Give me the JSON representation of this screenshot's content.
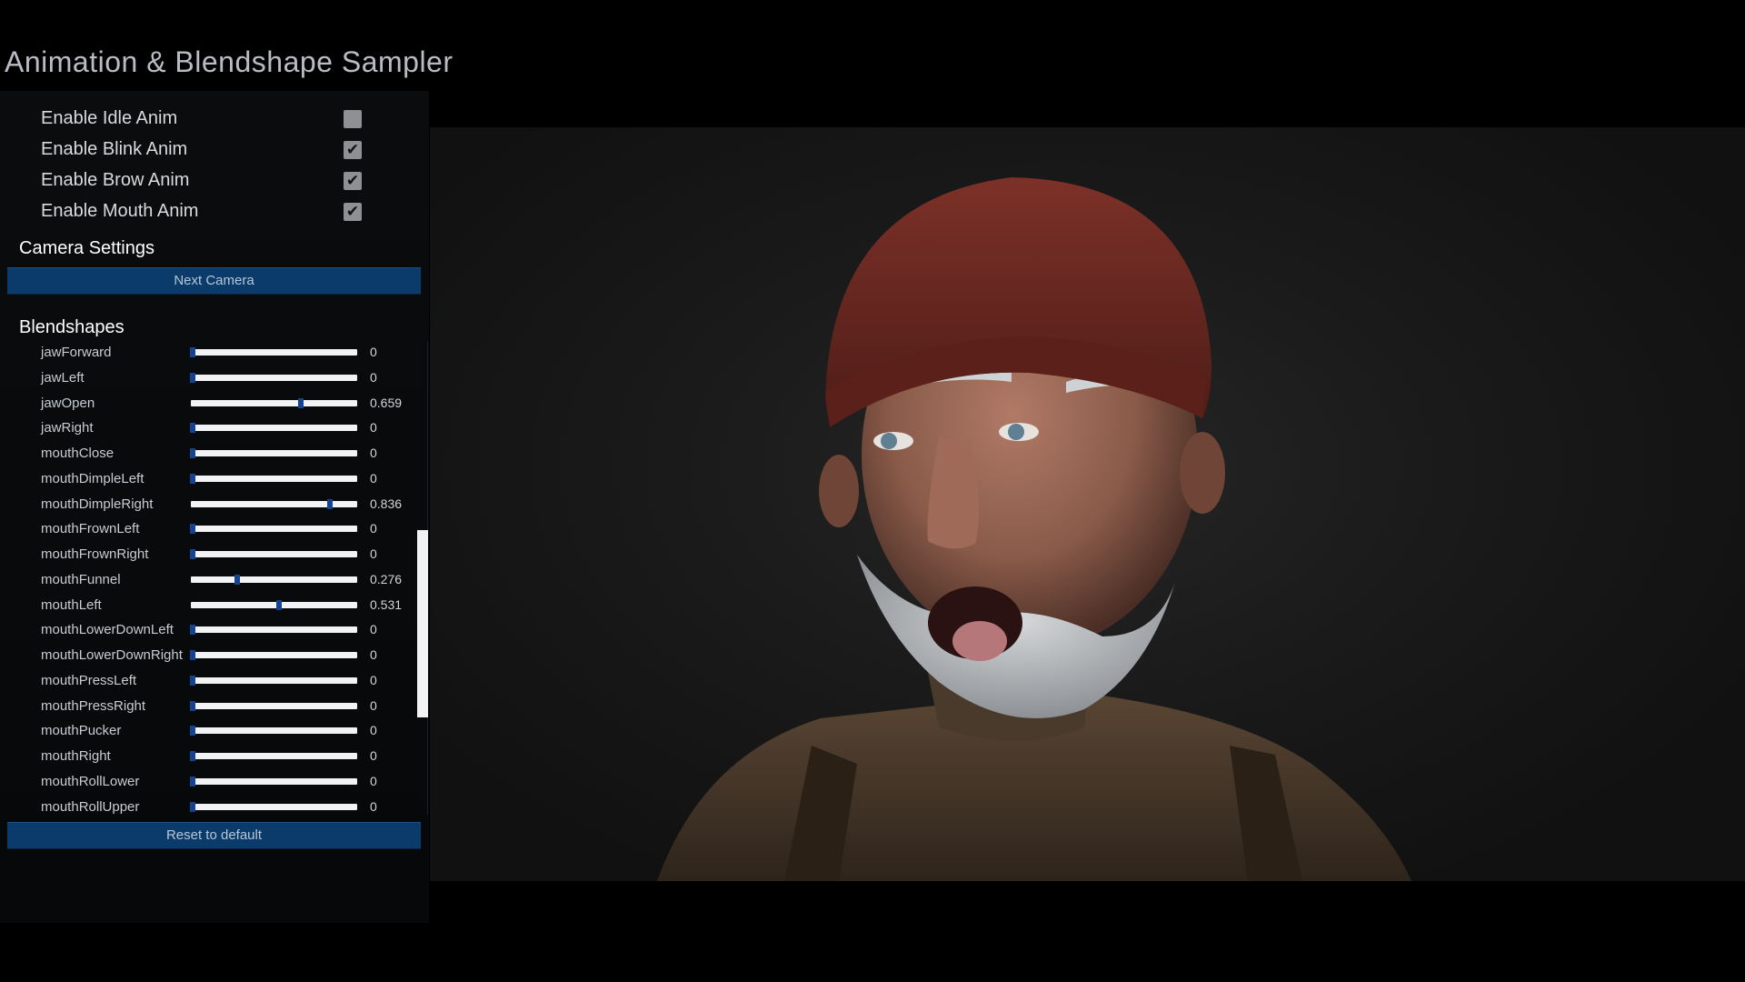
{
  "app": {
    "title": "Animation & Blendshape Sampler"
  },
  "toggles": [
    {
      "label": "Enable Idle Anim",
      "checked": false
    },
    {
      "label": "Enable Blink Anim",
      "checked": true
    },
    {
      "label": "Enable Brow Anim",
      "checked": true
    },
    {
      "label": "Enable Mouth Anim",
      "checked": true
    }
  ],
  "camera_settings": {
    "title": "Camera Settings",
    "next_label": "Next Camera"
  },
  "blendshapes": {
    "title": "Blendshapes",
    "items": [
      {
        "name": "jawForward",
        "value": 0,
        "display": "0"
      },
      {
        "name": "jawLeft",
        "value": 0,
        "display": "0"
      },
      {
        "name": "jawOpen",
        "value": 0.659,
        "display": "0.659"
      },
      {
        "name": "jawRight",
        "value": 0,
        "display": "0"
      },
      {
        "name": "mouthClose",
        "value": 0,
        "display": "0"
      },
      {
        "name": "mouthDimpleLeft",
        "value": 0,
        "display": "0"
      },
      {
        "name": "mouthDimpleRight",
        "value": 0.836,
        "display": "0.836"
      },
      {
        "name": "mouthFrownLeft",
        "value": 0,
        "display": "0"
      },
      {
        "name": "mouthFrownRight",
        "value": 0,
        "display": "0"
      },
      {
        "name": "mouthFunnel",
        "value": 0.276,
        "display": "0.276"
      },
      {
        "name": "mouthLeft",
        "value": 0.531,
        "display": "0.531"
      },
      {
        "name": "mouthLowerDownLeft",
        "value": 0,
        "display": "0"
      },
      {
        "name": "mouthLowerDownRight",
        "value": 0,
        "display": "0"
      },
      {
        "name": "mouthPressLeft",
        "value": 0,
        "display": "0"
      },
      {
        "name": "mouthPressRight",
        "value": 0,
        "display": "0"
      },
      {
        "name": "mouthPucker",
        "value": 0,
        "display": "0"
      },
      {
        "name": "mouthRight",
        "value": 0,
        "display": "0"
      },
      {
        "name": "mouthRollLower",
        "value": 0,
        "display": "0"
      },
      {
        "name": "mouthRollUpper",
        "value": 0,
        "display": "0"
      }
    ],
    "reset_label": "Reset to default"
  },
  "colors": {
    "button_bg": "#0a3b6a",
    "slider_thumb": "#17428f",
    "panel_bg": "#0a0c0e"
  }
}
